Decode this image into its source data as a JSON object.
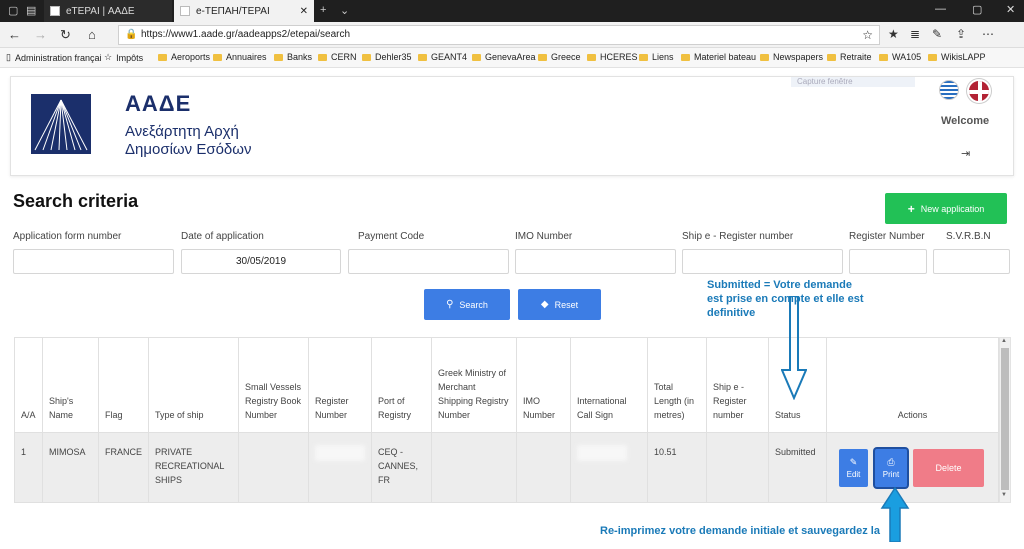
{
  "browser": {
    "tabs": [
      {
        "title": "eTEPAI | ΑΑΔΕ"
      },
      {
        "title": "e-ΤΕΠΑΗ/ΤΕΡΑΙ"
      }
    ],
    "url": "https://www1.aade.gr/aadeapps2/etepai/search",
    "favorites": [
      "Administration françai",
      "Impôts",
      "Aeroports",
      "Annuaires",
      "Banks",
      "CERN",
      "Dehler35",
      "GEANT4",
      "GenevaArea",
      "Greece",
      "HCERES",
      "Liens",
      "Materiel bateau",
      "Newspapers",
      "Retraite",
      "WA105",
      "WikisLAPP"
    ]
  },
  "header": {
    "brand": "ΑΑΔΕ",
    "brand_sub_line1": "Ανεξάρτητη Αρχή",
    "brand_sub_line2": "Δημοσίων Εσόδων",
    "capture_hint": "Capture fenêtre",
    "welcome": "Welcome"
  },
  "search": {
    "title": "Search criteria",
    "new_button": "New application",
    "fields": [
      {
        "label": "Application form number",
        "value": ""
      },
      {
        "label": "Date of application",
        "value": "30/05/2019"
      },
      {
        "label": "Payment Code",
        "value": ""
      },
      {
        "label": "IMO Number",
        "value": ""
      },
      {
        "label": "Ship e - Register number",
        "value": ""
      },
      {
        "label": "Register Number",
        "value": ""
      },
      {
        "label": "S.V.R.B.N",
        "value": ""
      }
    ],
    "search_button": "Search",
    "reset_button": "Reset"
  },
  "table": {
    "headers": [
      "A/A",
      "Ship's Name",
      "Flag",
      "Type of ship",
      "Small Vessels Registry Book Number",
      "Register Number",
      "Port of Registry",
      "Greek Ministry of Merchant Shipping Registry Number",
      "IMO Number",
      "International Call Sign",
      "Total Length (in metres)",
      "Ship e - Register number",
      "Status",
      "Actions"
    ],
    "rows": [
      {
        "aa": "1",
        "name": "MIMOSA",
        "flag": "FRANCE",
        "type": "PRIVATE RECREATIONAL SHIPS",
        "svrbn": "",
        "port": "CEQ - CANNES, FR",
        "gmms": "",
        "imo": "",
        "length": "10.51",
        "ereg": "",
        "status": "Submitted",
        "edit": "Edit",
        "print": "Print",
        "delete": "Delete"
      }
    ]
  },
  "annotations": {
    "top": "Submitted = Votre demande est prise en compte et elle est definitive",
    "bottom": "Re-imprimez votre demande initiale et sauvegardez la",
    "color": "#1a7ab8"
  },
  "colors": {
    "brand": "#1b2f6b",
    "primary": "#3d7de4",
    "success": "#22c156",
    "danger": "#f07c88"
  }
}
